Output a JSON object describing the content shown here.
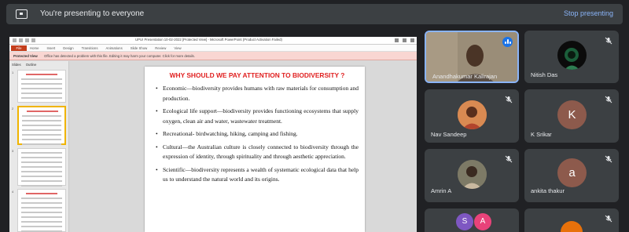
{
  "banner": {
    "text": "You're presenting to everyone",
    "stop_label": "Stop presenting"
  },
  "powerpoint": {
    "window_title": "UPU! Presentation 10-02-2022 [Protected View] - Microsoft PowerPoint (Product Activation Failed)",
    "file_tab": "File",
    "tabs": [
      "Home",
      "Insert",
      "Design",
      "Transitions",
      "Animations",
      "Slide Show",
      "Review",
      "View"
    ],
    "protected_label": "Protected View",
    "protected_message": "Office has detected a problem with this file. Editing it may harm your computer. Click for more details.",
    "pane_tabs": [
      "Slides",
      "Outline"
    ],
    "thumbnail_numbers": [
      "1",
      "2",
      "3",
      "4"
    ]
  },
  "slide": {
    "title": "WHY SHOULD WE PAY ATTENTION TO BIODIVERSITY ?",
    "bullets": [
      "Economic—biodiversity provides humans with raw materials for consumption and production.",
      "Ecological life support—biodiversity provides functioning ecosystems that supply oxygen, clean air and water,  wastewater treatment.",
      "Recreational- birdwatching, hiking, camping and fishing.",
      "Cultural—the Australian culture is closely connected to biodiversity through the expression of identity, through spirituality and through aesthetic appreciation.",
      "Scientific—biodiversity represents a wealth of systematic ecological data that help us to understand the natural world and its origins."
    ]
  },
  "participants": [
    {
      "name": "Anandhakumar Kalirajan",
      "speaking": true
    },
    {
      "name": "Nitish Das",
      "initial": "",
      "muted": true
    },
    {
      "name": "Nav Sandeep",
      "muted": true
    },
    {
      "name": "K Srikar",
      "initial": "K",
      "color": "#8d5a4c",
      "muted": true
    },
    {
      "name": "Amrin A",
      "muted": true
    },
    {
      "name": "ankita thakur",
      "initial": "a",
      "color": "#8d5a4c",
      "muted": true
    },
    {
      "name": "",
      "initials": [
        "S",
        "A"
      ],
      "colors": [
        "#7e57c2",
        "#e8437a"
      ]
    },
    {
      "name": "",
      "muted": true
    }
  ],
  "colors": {
    "background": "#202124",
    "tile": "#3c4043",
    "accent": "#8ab4f8",
    "slide_title": "#e02020"
  }
}
